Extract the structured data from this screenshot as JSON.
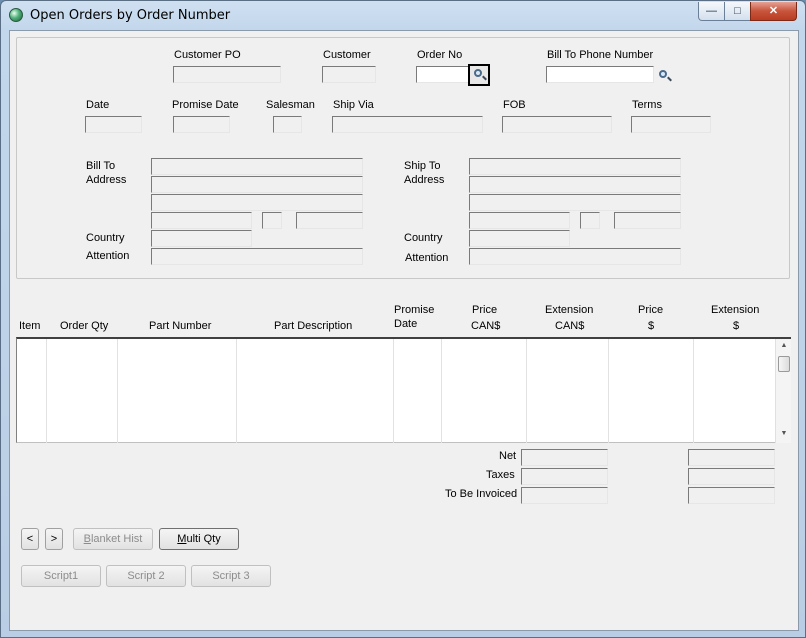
{
  "window": {
    "title": "Open Orders by Order Number",
    "controls": {
      "minimize": "—",
      "maximize": "□",
      "close": "✕"
    }
  },
  "header": {
    "customer_po": "Customer PO",
    "customer": "Customer",
    "order_no": "Order No",
    "bill_to_phone": "Bill To Phone Number",
    "date": "Date",
    "promise_date": "Promise Date",
    "salesman": "Salesman",
    "ship_via": "Ship Via",
    "fob": "FOB",
    "terms": "Terms"
  },
  "address": {
    "bill_to_line1": "Bill To",
    "bill_to_line2": "Address",
    "ship_to_line1": "Ship To",
    "ship_to_line2": "Address",
    "country": "Country",
    "attention": "Attention"
  },
  "grid": {
    "columns": {
      "item": "Item",
      "order_qty": "Order Qty",
      "part_number": "Part Number",
      "part_description": "Part Description",
      "promise_top": "Promise",
      "promise_bottom": "Date",
      "price_cad_top": "Price",
      "price_cad_bottom": "CAN$",
      "ext_cad_top": "Extension",
      "ext_cad_bottom": "CAN$",
      "price_usd_top": "Price",
      "price_usd_bottom": "$",
      "ext_usd_top": "Extension",
      "ext_usd_bottom": "$"
    },
    "scroll_up": "▲",
    "scroll_down": "▼"
  },
  "totals": {
    "net": "Net",
    "taxes": "Taxes",
    "to_be_invoiced": "To Be Invoiced"
  },
  "buttons": {
    "prev": "<",
    "next": ">",
    "blanket_hist_u": "B",
    "blanket_hist_rest": "lanket Hist",
    "multi_qty_u": "M",
    "multi_qty_rest": "ulti Qty",
    "script1": "Script1",
    "script2": "Script 2",
    "script3": "Script 3"
  },
  "icons": {
    "app": "app-globe-icon",
    "lookup": "magnifier-icon"
  }
}
